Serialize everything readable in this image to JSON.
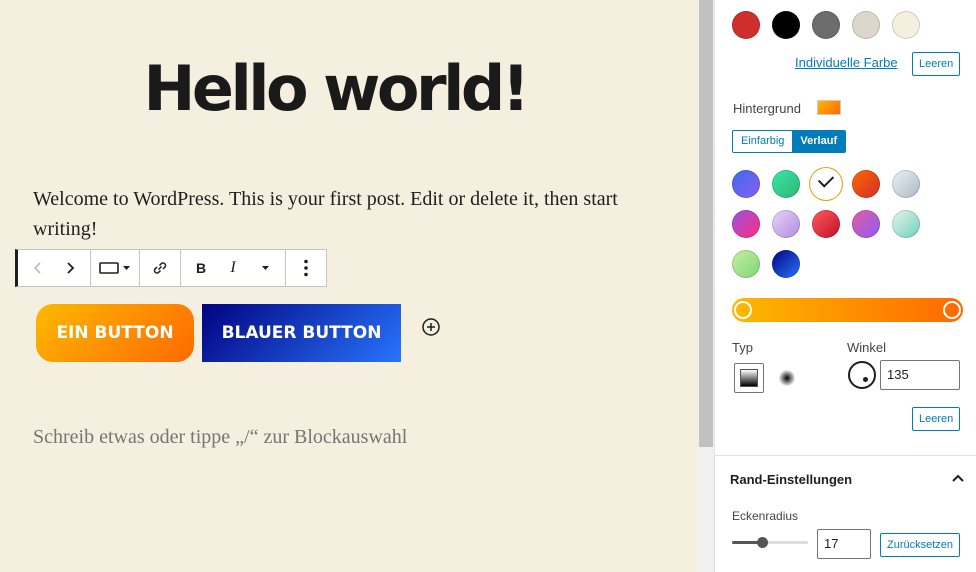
{
  "editor": {
    "title": "Hello world!",
    "paragraph": "Welcome to WordPress. This is your first post. Edit or delete it, then start writing!",
    "placeholder": "Schreib etwas oder tippe „/“ zur Blockauswahl",
    "buttons": [
      {
        "label": "EIN BUTTON",
        "gradient": [
          "#fcb900",
          "#ff6900"
        ]
      },
      {
        "label": "BLAUER BUTTON",
        "gradient": [
          "#020381",
          "#2874fc"
        ]
      }
    ],
    "toolbar": {
      "bold": "B",
      "italic": "I",
      "icons": [
        "chevron-left-icon",
        "chevron-right-icon",
        "button-style-icon",
        "caret-down-icon",
        "link-icon",
        "caret-down-icon",
        "more-vertical-icon"
      ]
    }
  },
  "sidebar": {
    "text_colors": [
      "#cf2e2e",
      "#000000",
      "#6d6d6d",
      "#dcd7ca",
      "#f5efe0"
    ],
    "custom_color_link": "Individuelle Farbe",
    "clear_label": "Leeren",
    "background_label": "Hintergrund",
    "tabs": [
      "Einfarbig",
      "Verlauf"
    ],
    "active_tab": "Verlauf",
    "gradients": [
      {
        "colors": [
          "#3a6ee8",
          "#8a5cf6"
        ],
        "selected": false
      },
      {
        "colors": [
          "#3ee6a6",
          "#2bb673"
        ],
        "selected": false
      },
      {
        "colors": [
          "#fcb900",
          "#ff6900"
        ],
        "selected": true
      },
      {
        "colors": [
          "#ff6900",
          "#cf2e2e"
        ],
        "selected": false
      },
      {
        "colors": [
          "#eef2f3",
          "#a9b8c8"
        ],
        "selected": false
      },
      {
        "colors": [
          "#9b51e0",
          "#ff2e7e"
        ],
        "selected": false
      },
      {
        "colors": [
          "#e8d4f8",
          "#b18ae0"
        ],
        "selected": false
      },
      {
        "colors": [
          "#ff5a5a",
          "#c0102a"
        ],
        "selected": false
      },
      {
        "colors": [
          "#e75da0",
          "#8a5cf6"
        ],
        "selected": false
      },
      {
        "colors": [
          "#e9f5e9",
          "#6ccfc0"
        ],
        "selected": false
      },
      {
        "colors": [
          "#c8f09a",
          "#7ed37e"
        ],
        "selected": false
      },
      {
        "colors": [
          "#020381",
          "#2874fc"
        ],
        "selected": false
      }
    ],
    "type_label": "Typ",
    "angle_label": "Winkel",
    "angle_value": "135",
    "border_panel_title": "Rand-Einstellungen",
    "radius_label": "Eckenradius",
    "radius_value": "17",
    "radius_fraction": 0.39,
    "reset_label": "Zurücksetzen"
  },
  "colors": {
    "accent": "#007cba",
    "canvas": "#f5efe0"
  }
}
